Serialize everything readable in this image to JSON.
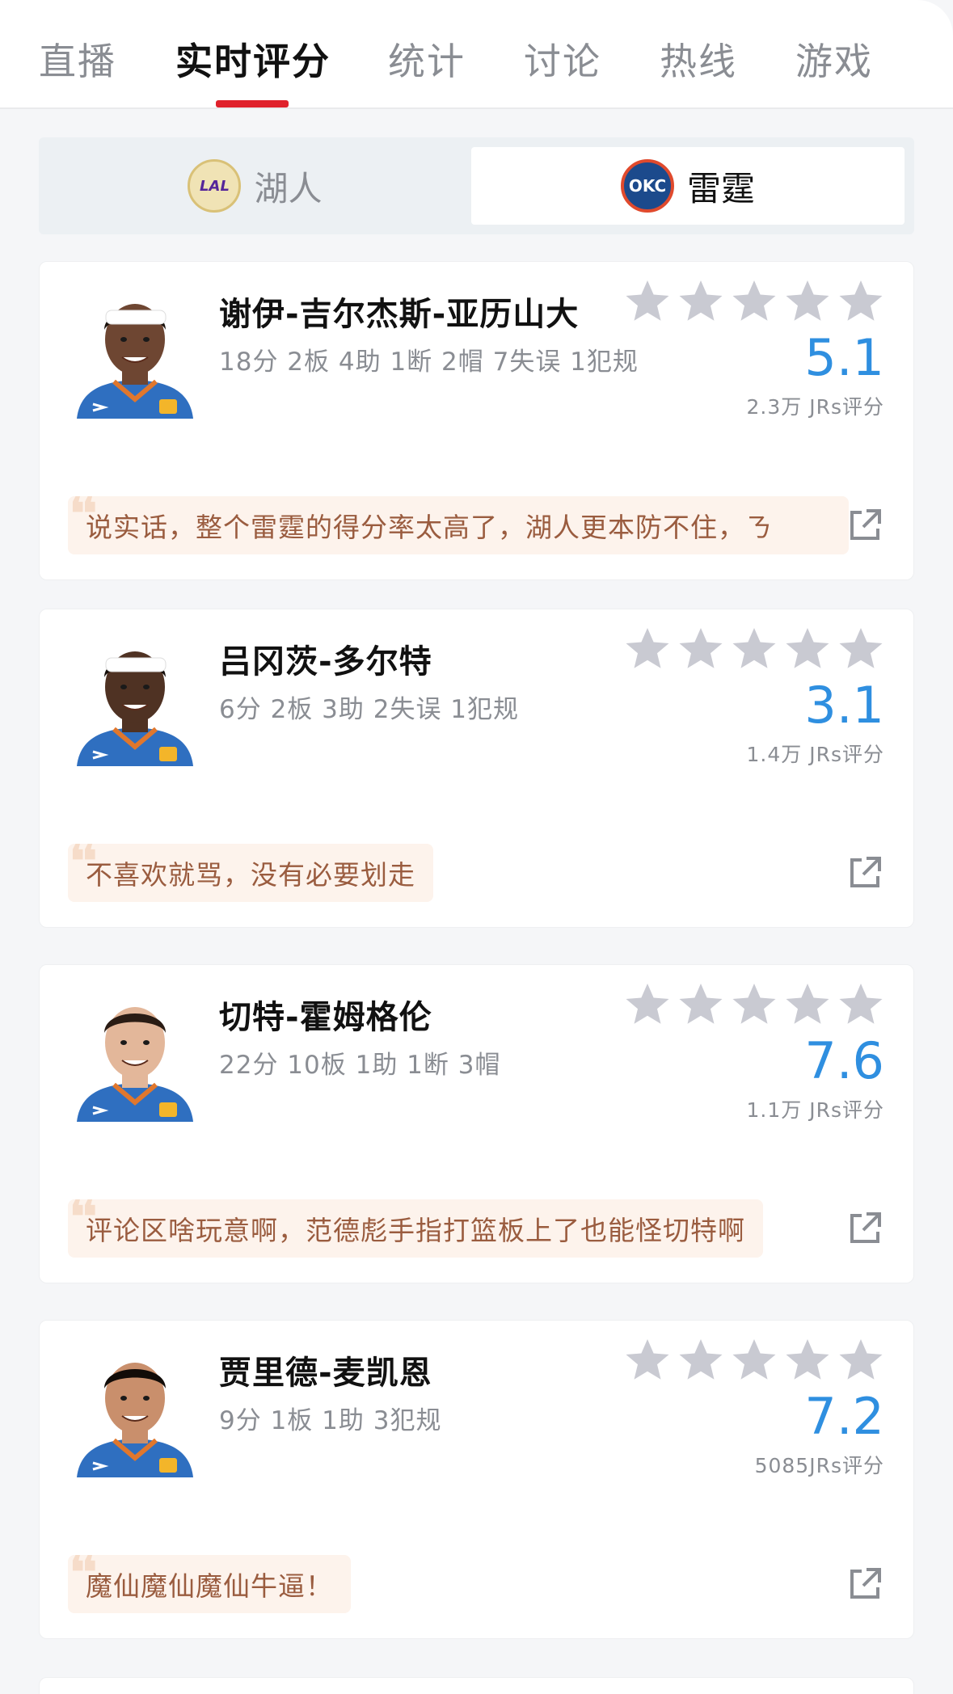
{
  "tabs": [
    {
      "label": "直播"
    },
    {
      "label": "实时评分"
    },
    {
      "label": "统计"
    },
    {
      "label": "讨论"
    },
    {
      "label": "热线"
    },
    {
      "label": "游戏"
    }
  ],
  "active_tab": "实时评分",
  "teams": {
    "left": {
      "name": "湖人",
      "logo_text": "LAL",
      "selected": false
    },
    "right": {
      "name": "雷霆",
      "logo_text": "OKC",
      "selected": true
    }
  },
  "colors": {
    "accent": "#e0212b",
    "score": "#2f8fe0",
    "star": "#c9cad2",
    "comment_bg": "#fdf3ec",
    "comment_text": "#9a5c3f"
  },
  "players": [
    {
      "name": "谢伊-吉尔杰斯-亚历山大",
      "stats": "18分 2板 4助 1断 2帽 7失误 1犯规",
      "score": "5.1",
      "votes": "2.3万 JRs评分",
      "stars_filled": 0,
      "comment": "说实话，整个雷霆的得分率太高了，湖人更本防不住，ㄋ",
      "skin": "#6e4632",
      "hair": "#1a120d",
      "headband": true
    },
    {
      "name": "吕冈茨-多尔特",
      "stats": "6分 2板 3助 2失误 1犯规",
      "score": "3.1",
      "votes": "1.4万 JRs评分",
      "stars_filled": 0,
      "comment": "不喜欢就骂，没有必要划走",
      "skin": "#4f3223",
      "hair": "#140d09",
      "headband": true
    },
    {
      "name": "切特-霍姆格伦",
      "stats": "22分 10板 1助 1断 3帽",
      "score": "7.6",
      "votes": "1.1万 JRs评分",
      "stars_filled": 0,
      "comment": "评论区啥玩意啊，范德彪手指打篮板上了也能怪切特啊",
      "skin": "#e3b79a",
      "hair": "#2a1c14",
      "headband": false
    },
    {
      "name": "贾里德-麦凯恩",
      "stats": "9分 1板 1助 3犯规",
      "score": "7.2",
      "votes": "5085JRs评分",
      "stars_filled": 0,
      "comment": "魔仙魔仙魔仙牛逼！",
      "skin": "#c98f6c",
      "hair": "#120c08",
      "headband": false
    }
  ]
}
